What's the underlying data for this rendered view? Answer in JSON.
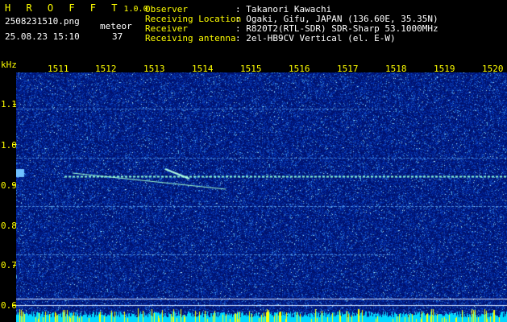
{
  "app": {
    "brand": "H R O F F T",
    "version": "1.0.0",
    "filename": "2508231510.png",
    "datetime": "25.08.23 15:10",
    "meteor_label": "meteor",
    "meteor_count": "37"
  },
  "info": {
    "rows": [
      {
        "label": "Observer",
        "value": ": Takanori Kawachi"
      },
      {
        "label": "Receiving Location",
        "value": ": Ogaki, Gifu, JAPAN (136.60E, 35.35N)"
      },
      {
        "label": "Receiver",
        "value": ": R820T2(RTL-SDR) SDR-Sharp 53.1000MHz"
      },
      {
        "label": "Receiving antenna",
        "value": ": 2el-HB9CV Vertical (el. E-W)"
      }
    ]
  },
  "axes": {
    "x_ticks": [
      "1511",
      "1512",
      "1513",
      "1514",
      "1515",
      "1516",
      "1517",
      "1518",
      "1519",
      "1520"
    ],
    "y_unit": "kHz",
    "y_ticks": [
      "1.1",
      "1.0",
      "0.9",
      "0.8",
      "0.7",
      "0.6"
    ]
  },
  "colors": {
    "label": "#ffff00",
    "text": "#ffffff",
    "background": "#000000",
    "spectrum": "#001a8c",
    "signal": "#a0ffd0"
  }
}
